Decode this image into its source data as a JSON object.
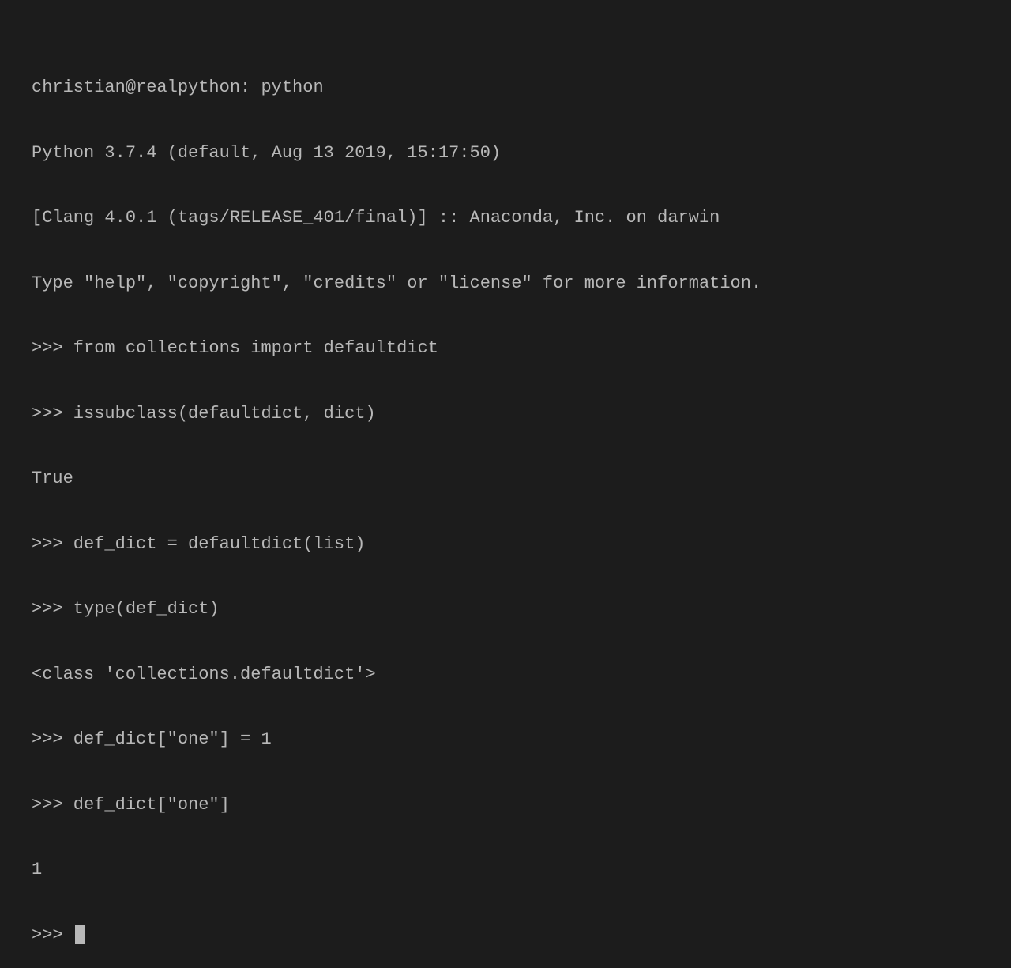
{
  "terminal": {
    "lines": [
      "christian@realpython: python",
      "Python 3.7.4 (default, Aug 13 2019, 15:17:50)",
      "[Clang 4.0.1 (tags/RELEASE_401/final)] :: Anaconda, Inc. on darwin",
      "Type \"help\", \"copyright\", \"credits\" or \"license\" for more information.",
      ">>> from collections import defaultdict",
      ">>> issubclass(defaultdict, dict)",
      "True",
      ">>> def_dict = defaultdict(list)",
      ">>> type(def_dict)",
      "<class 'collections.defaultdict'>",
      ">>> def_dict[\"one\"] = 1",
      ">>> def_dict[\"one\"]",
      "1"
    ],
    "prompt": ">>> "
  }
}
